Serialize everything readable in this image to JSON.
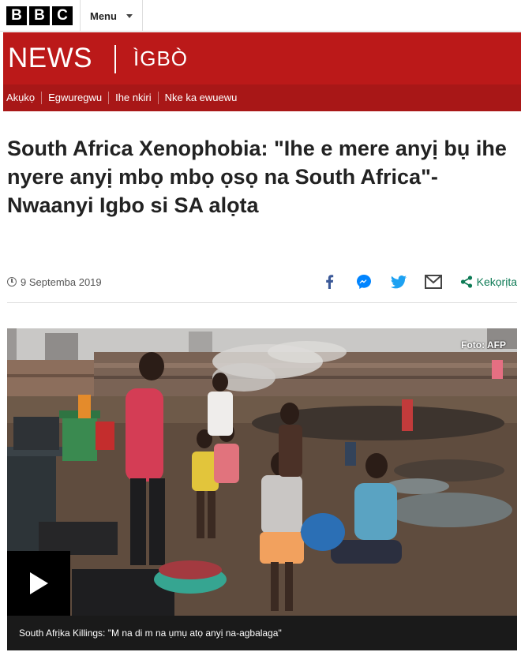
{
  "header": {
    "logo_letters": [
      "B",
      "B",
      "C"
    ],
    "menu_label": "Menu"
  },
  "banner": {
    "title": "NEWS",
    "language": "ÌGBÒ",
    "color": "#bb1919"
  },
  "nav": {
    "items": [
      "Akụkọ",
      "Egwuregwu",
      "Ihe nkiri",
      "Nke ka ewuewu"
    ]
  },
  "article": {
    "headline": "South Africa Xenophobia: \"Ihe e mere anyị bụ ihe nyere anyị mbọ mbọ ọsọ na South Africa\"- Nwaanyi Igbo si SA alọta",
    "date": "9 Septemba 2019"
  },
  "share": {
    "icons": [
      "facebook-icon",
      "messenger-icon",
      "twitter-icon",
      "email-icon"
    ],
    "label": "Kekọrịta",
    "color": "#0d7a55"
  },
  "media": {
    "credit": "Foto: AFP",
    "caption": "South Afrịka Killings: \"M na di m na ụmụ atọ anyị na-agbalaga\""
  }
}
